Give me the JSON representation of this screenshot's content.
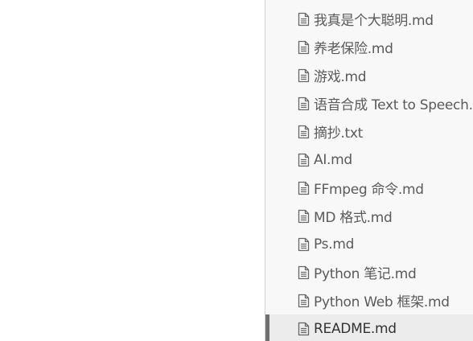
{
  "sidebar": {
    "files": [
      {
        "name": "我真是个大聪明.md",
        "icon": "document-icon",
        "active": false
      },
      {
        "name": "养老保险.md",
        "icon": "document-icon",
        "active": false
      },
      {
        "name": "游戏.md",
        "icon": "document-icon",
        "active": false
      },
      {
        "name": "语音合成 Text to Speech.md",
        "icon": "document-icon",
        "active": false
      },
      {
        "name": "摘抄.txt",
        "icon": "document-icon",
        "active": false
      },
      {
        "name": "AI.md",
        "icon": "document-icon",
        "active": false
      },
      {
        "name": "FFmpeg 命令.md",
        "icon": "document-icon",
        "active": false
      },
      {
        "name": "MD 格式.md",
        "icon": "document-icon",
        "active": false
      },
      {
        "name": "Ps.md",
        "icon": "document-icon",
        "active": false
      },
      {
        "name": "Python 笔记.md",
        "icon": "document-icon",
        "active": false
      },
      {
        "name": "Python Web 框架.md",
        "icon": "document-icon",
        "active": false
      },
      {
        "name": "README.md",
        "icon": "document-icon",
        "active": true
      }
    ]
  },
  "colors": {
    "sidebar_bg": "#f8f8f8",
    "active_bg": "#ececec",
    "active_marker": "#707070",
    "text": "#5a5a5a"
  }
}
